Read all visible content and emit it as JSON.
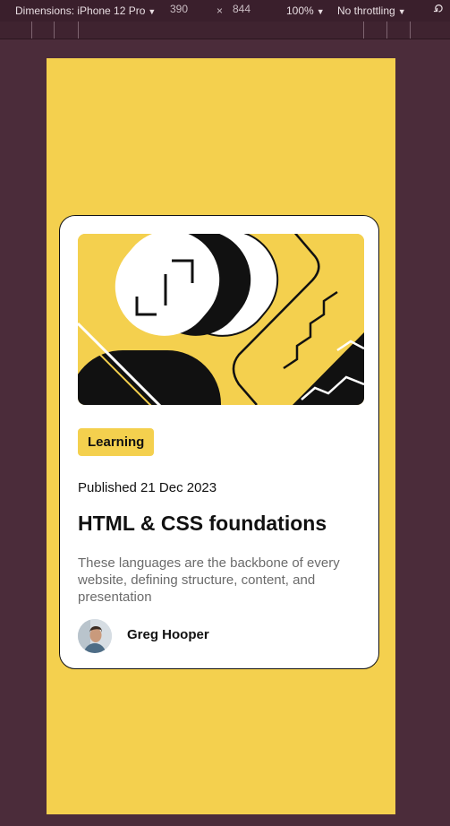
{
  "devtools": {
    "device_label": "Dimensions: iPhone 12 Pro",
    "width_value": "390",
    "times": "×",
    "height_value": "844",
    "zoom": "100%",
    "throttling": "No throttling"
  },
  "card": {
    "tag": "Learning",
    "published": "Published 21 Dec 2023",
    "title": "HTML & CSS foundations",
    "description": "These languages are the backbone of every website, defining structure, content, and presentation",
    "author": "Greg Hooper"
  },
  "colors": {
    "page_background": "#f4d04e",
    "card_background": "#ffffff",
    "text": "#111111",
    "muted_text": "#6b6b6b",
    "devtools_background": "#4b2c3a"
  }
}
